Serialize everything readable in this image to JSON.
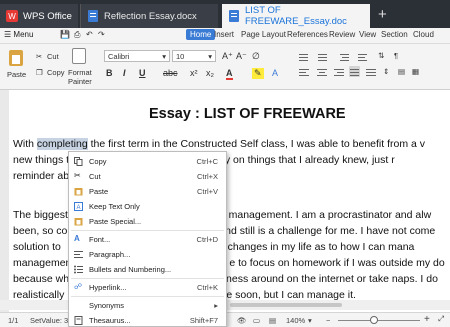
{
  "tabs": {
    "app": "WPS Office",
    "doc1": "Reflection Essay.docx",
    "doc2": "LIST OF FREEWARE_Essay.doc",
    "add": "+"
  },
  "menubar": {
    "menu": "Menu",
    "items": [
      "Home",
      "Insert",
      "Page Layout",
      "References",
      "Review",
      "View",
      "Section",
      "Cloud"
    ]
  },
  "ribbon": {
    "paste": "Paste",
    "cut": "Cut",
    "copy": "Copy",
    "format_painter_1": "Format",
    "format_painter_2": "Painter",
    "font_name": "Calibri",
    "font_size": "10",
    "bold": "B",
    "italic": "I",
    "underline": "U",
    "font_color": "A"
  },
  "document": {
    "title": "Essay : LIST OF FREEWARE",
    "lines": {
      "p1a_pre": "With ",
      "p1a_sel": "completing",
      "p1a_post": " the first term in the Constructed Self class, I was able to benefit from a v",
      "p1b_pre": "new things t",
      "p1b_post": "y memory on things that I already knew, just r",
      "p1c": "reminder ab",
      "p2a_pre": "The biggest",
      "p2a_post": "e management. I am a procrastinator and alw",
      "p2b_pre": "been, so co",
      "p2b_post": "and still is a challenge for me. I have not come",
      "p2c_pre": "solution to",
      "p2c_post": "e changes in my life as to how I can mana",
      "p2d_pre": "managemen",
      "p2d_post": "e to focus on homework if I was outside my do",
      "p2e_pre": "because wh",
      "p2e_post": "ness around on the internet or take naps. I do",
      "p2f_pre": "realistically",
      "p2f_post": "e soon, but I can manage it."
    }
  },
  "context_menu": {
    "items": [
      {
        "label": "Copy",
        "shortcut": "Ctrl+C"
      },
      {
        "label": "Cut",
        "shortcut": "Ctrl+X"
      },
      {
        "label": "Paste",
        "shortcut": "Ctrl+V"
      },
      {
        "label": "Keep Text Only",
        "shortcut": ""
      },
      {
        "label": "Paste Special...",
        "shortcut": ""
      },
      {
        "label": "Font...",
        "shortcut": "Ctrl+D"
      },
      {
        "label": "Paragraph...",
        "shortcut": ""
      },
      {
        "label": "Bullets and Numbering...",
        "shortcut": ""
      },
      {
        "label": "Hyperlink...",
        "shortcut": "Ctrl+K"
      },
      {
        "label": "Synonyms",
        "shortcut": "▸"
      },
      {
        "label": "Thesaurus...",
        "shortcut": "Shift+F7"
      }
    ]
  },
  "statusbar": {
    "page": "1/1",
    "setvalue": "SetValue: 3.",
    "zoom": "140%",
    "minus": "−",
    "plus": "+"
  },
  "colors": {
    "accent": "#3a7bd5",
    "tabbar": "#2b2f36",
    "selection": "#c7d3e2"
  }
}
